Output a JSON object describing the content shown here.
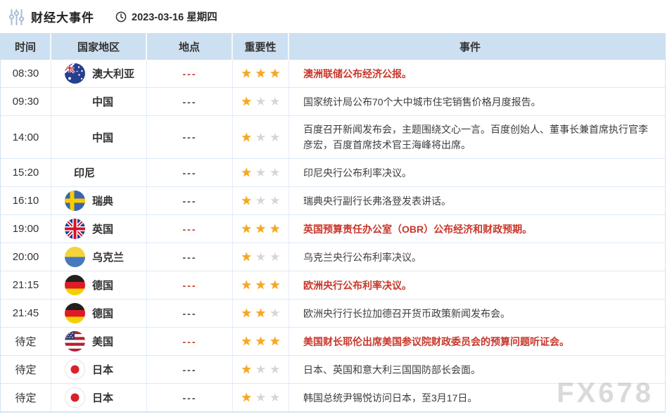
{
  "header": {
    "title": "财经大事件",
    "date": "2023-03-16 星期四"
  },
  "table": {
    "columns": [
      "时间",
      "国家地区",
      "地点",
      "重要性",
      "事件"
    ],
    "rows": [
      {
        "time": "08:30",
        "country": "澳大利亚",
        "flag": "australia",
        "location": "---",
        "stars": 3,
        "event": "澳洲联储公布经济公报。",
        "highlight": true
      },
      {
        "time": "09:30",
        "country": "中国",
        "flag": "blank",
        "location": "---",
        "stars": 1,
        "event": "国家统计局公布70个大中城市住宅销售价格月度报告。",
        "highlight": false
      },
      {
        "time": "14:00",
        "country": "中国",
        "flag": "blank",
        "location": "---",
        "stars": 1,
        "event": "百度召开新闻发布会，主题围绕文心一言。百度创始人、董事长兼首席执行官李彦宏，百度首席技术官王海峰将出席。",
        "highlight": false
      },
      {
        "time": "15:20",
        "country": "印尼",
        "flag": "none",
        "location": "---",
        "stars": 1,
        "event": "印尼央行公布利率决议。",
        "highlight": false
      },
      {
        "time": "16:10",
        "country": "瑞典",
        "flag": "sweden",
        "location": "---",
        "stars": 1,
        "event": "瑞典央行副行长弗洛登发表讲话。",
        "highlight": false
      },
      {
        "time": "19:00",
        "country": "英国",
        "flag": "uk",
        "location": "---",
        "stars": 3,
        "event": "英国预算责任办公室（OBR）公布经济和财政预期。",
        "highlight": true
      },
      {
        "time": "20:00",
        "country": "乌克兰",
        "flag": "ukraine",
        "location": "---",
        "stars": 1,
        "event": "乌克兰央行公布利率决议。",
        "highlight": false
      },
      {
        "time": "21:15",
        "country": "德国",
        "flag": "germany",
        "location": "---",
        "stars": 3,
        "event": "欧洲央行公布利率决议。",
        "highlight": true
      },
      {
        "time": "21:45",
        "country": "德国",
        "flag": "germany",
        "location": "---",
        "stars": 2,
        "event": "欧洲央行行长拉加德召开货币政策新闻发布会。",
        "highlight": false
      },
      {
        "time": "待定",
        "country": "美国",
        "flag": "usa",
        "location": "---",
        "stars": 3,
        "event": "美国财长耶伦出席美国参议院财政委员会的预算问题听证会。",
        "highlight": true
      },
      {
        "time": "待定",
        "country": "日本",
        "flag": "japan",
        "location": "---",
        "stars": 1,
        "event": "日本、英国和意大利三国国防部长会面。",
        "highlight": false
      },
      {
        "time": "待定",
        "country": "日本",
        "flag": "japan",
        "location": "---",
        "stars": 1,
        "event": "韩国总统尹锡悦访问日本，至3月17日。",
        "highlight": false
      }
    ],
    "stars_total": 3
  },
  "watermark": "FX678",
  "colors": {
    "highlight_red": "#c9372b",
    "star_gold": "#f6a81f",
    "star_gray": "#d6d6d6",
    "header_bg": "#cde0f2",
    "border_blue": "#dce9f6"
  }
}
